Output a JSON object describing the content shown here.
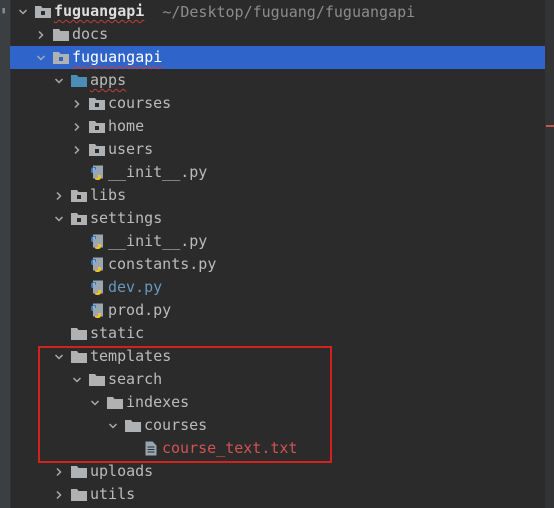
{
  "colors": {
    "background": "#2b2b2b",
    "selection": "#2f65ca",
    "folder": "#afb1b3",
    "source_folder": "#4a8db7",
    "modified_file": "#6897bb",
    "untracked_file": "#d25252",
    "highlight_box": "#d0231f"
  },
  "tree": {
    "root": {
      "label": "fuguangapi",
      "path": "~/Desktop/fuguang/fuguangapi",
      "expanded": true
    },
    "items": [
      {
        "label": "docs",
        "icon": "folder-icon",
        "expanded": false
      },
      {
        "label": "fuguangapi",
        "icon": "module-folder-icon",
        "expanded": true,
        "selected": true
      },
      {
        "label": "apps",
        "icon": "source-folder-icon",
        "expanded": true
      },
      {
        "label": "courses",
        "icon": "package-folder-icon",
        "expanded": false
      },
      {
        "label": "home",
        "icon": "package-folder-icon",
        "expanded": false
      },
      {
        "label": "users",
        "icon": "package-folder-icon",
        "expanded": false
      },
      {
        "label": "__init__.py",
        "icon": "python-file-icon"
      },
      {
        "label": "libs",
        "icon": "package-folder-icon",
        "expanded": false
      },
      {
        "label": "settings",
        "icon": "package-folder-icon",
        "expanded": true
      },
      {
        "label": "__init__.py",
        "icon": "python-file-icon"
      },
      {
        "label": "constants.py",
        "icon": "python-file-icon"
      },
      {
        "label": "dev.py",
        "icon": "python-file-icon",
        "status": "modified"
      },
      {
        "label": "prod.py",
        "icon": "python-file-icon"
      },
      {
        "label": "static",
        "icon": "folder-icon"
      },
      {
        "label": "templates",
        "icon": "folder-icon",
        "expanded": true
      },
      {
        "label": "search",
        "icon": "folder-icon",
        "expanded": true
      },
      {
        "label": "indexes",
        "icon": "folder-icon",
        "expanded": true
      },
      {
        "label": "courses",
        "icon": "folder-icon",
        "expanded": true
      },
      {
        "label": "course_text.txt",
        "icon": "text-file-icon",
        "status": "untracked"
      },
      {
        "label": "uploads",
        "icon": "folder-icon",
        "expanded": false
      },
      {
        "label": "utils",
        "icon": "folder-icon",
        "expanded": false
      }
    ]
  }
}
